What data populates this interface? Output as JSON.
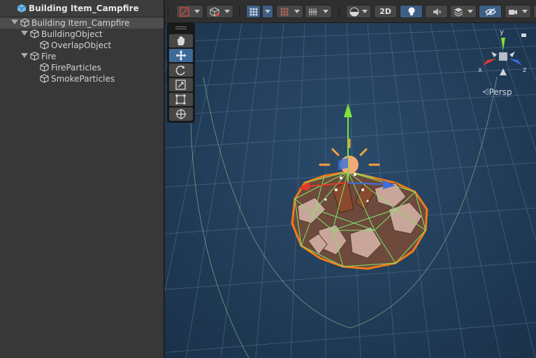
{
  "hierarchy": {
    "title": "Building Item_Campfire",
    "items": [
      {
        "label": "Building Item_Campfire",
        "depth": 0,
        "expanded": true,
        "selected": true
      },
      {
        "label": "BuildingObject",
        "depth": 1,
        "expanded": true
      },
      {
        "label": "OverlapObject",
        "depth": 2
      },
      {
        "label": "Fire",
        "depth": 1,
        "expanded": true
      },
      {
        "label": "FireParticles",
        "depth": 2
      },
      {
        "label": "SmokeParticles",
        "depth": 2
      }
    ]
  },
  "scene": {
    "toolbar": {
      "mode_2d_label": "2D",
      "buttons": [
        "draw-mode-dropdown",
        "shading-dropdown",
        "grid-snap-toggle",
        "snap-increment-dropdown",
        "grid-visibility-dropdown",
        "render-mode-dropdown",
        "2d-toggle",
        "lighting-toggle",
        "audio-toggle",
        "effects-dropdown",
        "hidden-objects-toggle",
        "camera-dropdown"
      ]
    },
    "tools": [
      "hand-tool",
      "move-tool",
      "rotate-tool",
      "scale-tool",
      "rect-tool",
      "transform-tool"
    ],
    "active_tool": "move-tool",
    "gizmo": {
      "y_label": "y",
      "x_label": "x",
      "z_label": "z",
      "projection_label": "Persp"
    }
  },
  "colors": {
    "panel_bg": "#383838",
    "selection_bg": "#4d4d4d",
    "scene_bg": "#1f3a56",
    "accent_active": "#3d6b99",
    "axis_x": "#e03a2a",
    "axis_y": "#7fe23a",
    "axis_z": "#3a6fe0",
    "collider_green": "#7ce86a",
    "selection_outline": "#f07a1a"
  }
}
